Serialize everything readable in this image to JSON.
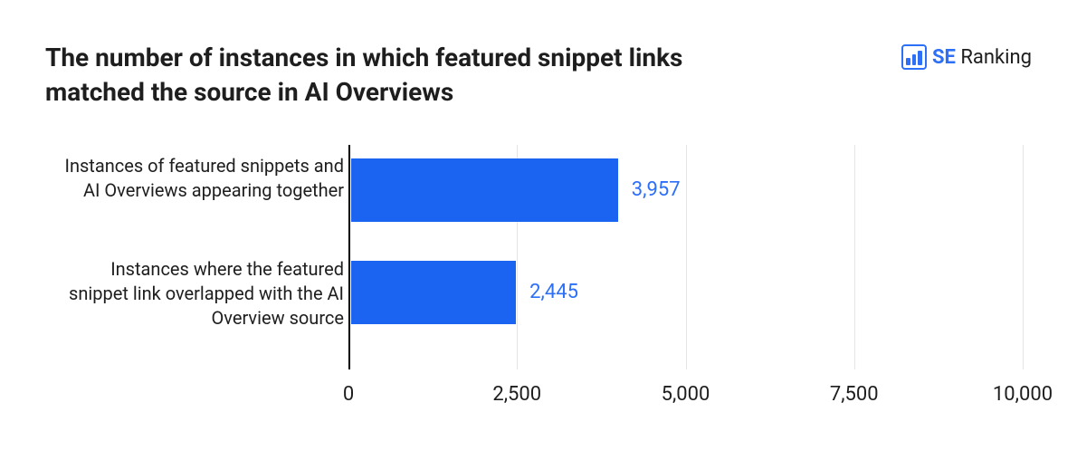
{
  "header": {
    "title": "The number of instances in which featured snippet links matched the source in AI Overviews"
  },
  "logo": {
    "brand_bold": "SE",
    "brand_rest": " Ranking"
  },
  "chart_data": {
    "type": "bar",
    "orientation": "horizontal",
    "categories": [
      "Instances of featured snippets and AI Overviews appearing together",
      "Instances where the featured snippet link overlapped with the AI Overview source"
    ],
    "values": [
      3957,
      2445
    ],
    "value_labels": [
      "3,957",
      "2,445"
    ],
    "xlim": [
      0,
      10000
    ],
    "xticks": [
      0,
      2500,
      5000,
      7500,
      10000
    ],
    "xtick_labels": [
      "0",
      "2,500",
      "5,000",
      "7,500",
      "10,000"
    ],
    "title": "",
    "xlabel": "",
    "ylabel": "",
    "bar_color": "#1b63f1",
    "label_color": "#2d6ff7"
  }
}
